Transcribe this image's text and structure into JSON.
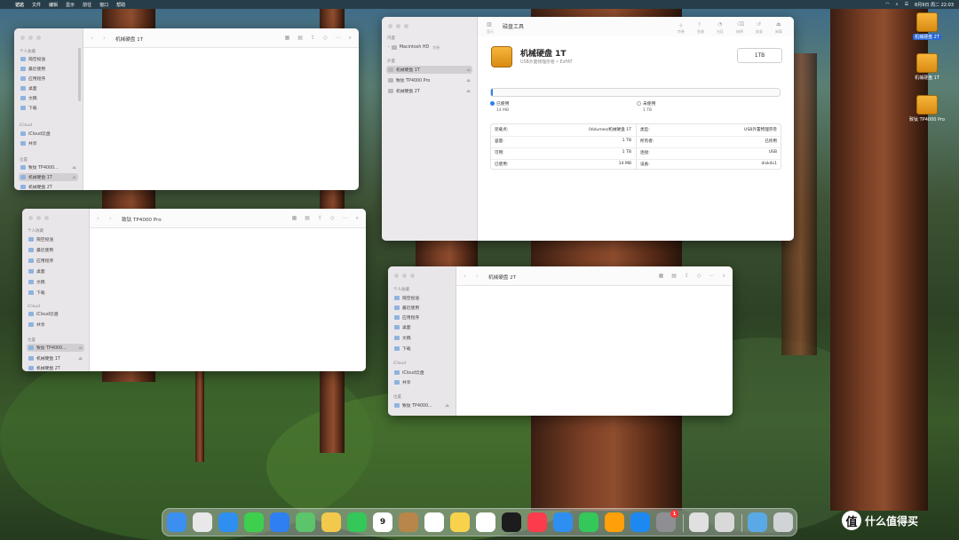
{
  "menubar": {
    "apple": "",
    "items": [
      "访达",
      "文件",
      "编辑",
      "显示",
      "前往",
      "窗口",
      "帮助"
    ],
    "clock": "8月9日 周二 22:03"
  },
  "window1": {
    "title": "机械硬盘 1T",
    "sections": {
      "personal": "个人收藏",
      "icloud": "iCloud",
      "locations": "位置"
    },
    "personal_items": [
      "隔空投送",
      "最近使用",
      "应用程序",
      "桌面",
      "文稿",
      "下载"
    ],
    "icloud_items": [
      "iCloud云盘",
      "共享"
    ],
    "location_items": [
      "致钛 TP4000...",
      "机械硬盘 1T",
      "机械硬盘 2T"
    ]
  },
  "window2": {
    "title": "致钛 TP4000 Pro",
    "sections": {
      "personal": "个人收藏",
      "icloud": "iCloud",
      "locations": "位置"
    },
    "personal_items": [
      "隔空投送",
      "最近使用",
      "应用程序",
      "桌面",
      "文稿",
      "下载"
    ],
    "icloud_items": [
      "iCloud云盘",
      "共享"
    ],
    "location_items": [
      "致钛 TP4000...",
      "机械硬盘 1T",
      "机械硬盘 2T"
    ]
  },
  "window3": {
    "title": "机械硬盘 2T",
    "sections": {
      "personal": "个人收藏",
      "icloud": "iCloud",
      "locations": "位置"
    },
    "personal_items": [
      "隔空投送",
      "最近使用",
      "应用程序",
      "桌面",
      "文稿",
      "下载"
    ],
    "icloud_items": [
      "iCloud云盘",
      "共享"
    ],
    "location_items": [
      "致钛 TP4000..."
    ]
  },
  "disk_utility": {
    "app_title": "磁盘工具",
    "view_label": "显示",
    "sections": {
      "internal": "内置",
      "external": "外置"
    },
    "internal_items": [
      {
        "name": "Macintosh HD",
        "badge": "宗卷"
      }
    ],
    "external_items": [
      "机械硬盘 1T",
      "致钛 TP4000 Pro",
      "机械硬盘 2T"
    ],
    "toolbar": [
      "宗卷",
      "急救",
      "分区",
      "抹掉",
      "恢复",
      "卸载",
      "信息"
    ],
    "disk_name": "机械硬盘 1T",
    "disk_desc": "USB外置物理宗卷 • ExFAT",
    "capacity_badge": "1TB",
    "usage": {
      "used_label": "已使用",
      "used_value": "14 MB",
      "free_label": "未使用",
      "free_value": "1 TB",
      "used_fraction": 0.0002
    },
    "info_left": [
      {
        "label": "装载点:",
        "value": "/Volumes/机械硬盘 1T"
      },
      {
        "label": "容量:",
        "value": "1 TB"
      },
      {
        "label": "可用:",
        "value": "1 TB"
      },
      {
        "label": "已使用:",
        "value": "14 MB"
      }
    ],
    "info_right": [
      {
        "label": "类型:",
        "value": "USB外置物理宗卷"
      },
      {
        "label": "所有者:",
        "value": "已停用"
      },
      {
        "label": "连接:",
        "value": "USB"
      },
      {
        "label": "设备:",
        "value": "disk4s1"
      }
    ]
  },
  "desktop_icons": [
    "机械硬盘 2T",
    "机械硬盘 1T",
    "致钛 TP4000 Pro"
  ],
  "dock": {
    "apps": [
      {
        "icon": "finder-icon",
        "color": "#3b8ff0"
      },
      {
        "icon": "launchpad-icon",
        "color": "#e8e8e8"
      },
      {
        "icon": "safari-icon",
        "color": "#2f8ff0"
      },
      {
        "icon": "messages-icon",
        "color": "#3ecf4f"
      },
      {
        "icon": "mail-icon",
        "color": "#2d7ff2"
      },
      {
        "icon": "maps-icon",
        "color": "#5cc46a"
      },
      {
        "icon": "photos-icon",
        "color": "#f2c94c"
      },
      {
        "icon": "facetime-icon",
        "color": "#34c759"
      },
      {
        "icon": "calendar-icon",
        "color": "#ffffff"
      },
      {
        "icon": "notes-brown-icon",
        "color": "#b8864a"
      },
      {
        "icon": "reminders-icon",
        "color": "#ffffff"
      },
      {
        "icon": "notes-icon",
        "color": "#f8d24a"
      },
      {
        "icon": "freeform-icon",
        "color": "#ffffff"
      },
      {
        "icon": "appletv-icon",
        "color": "#1c1c1e"
      },
      {
        "icon": "music-icon",
        "color": "#fa3c4c"
      },
      {
        "icon": "keynote-icon",
        "color": "#2f8ff0"
      },
      {
        "icon": "numbers-icon",
        "color": "#34c759"
      },
      {
        "icon": "pages-icon",
        "color": "#ff9f0a"
      },
      {
        "icon": "appstore-icon",
        "color": "#1e88f2"
      },
      {
        "icon": "settings-icon",
        "color": "#8e8e93"
      },
      {
        "icon": "preview-icon",
        "color": "#e0e0e0"
      },
      {
        "icon": "disk-utility-icon",
        "color": "#d9d9d9"
      },
      {
        "icon": "downloads-folder-icon",
        "color": "#5aa9e6"
      },
      {
        "icon": "trash-icon",
        "color": "#d0d4d6"
      }
    ],
    "calendar_day": "9",
    "settings_badge": "1"
  },
  "watermark": {
    "text": "什么值得买",
    "glyph": "值"
  }
}
